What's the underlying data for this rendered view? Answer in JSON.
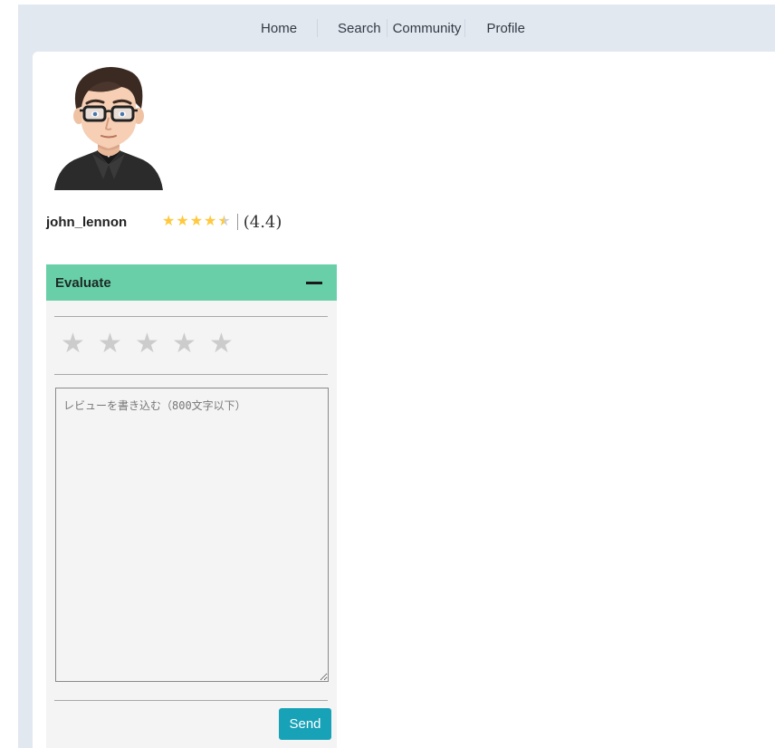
{
  "nav": {
    "items": [
      {
        "label": "Home"
      },
      {
        "label": "Search"
      },
      {
        "label": "Community"
      },
      {
        "label": "Profile"
      }
    ]
  },
  "profile": {
    "username": "john_lennon",
    "rating_value": 4.4,
    "rating_text": "(4.4)",
    "avatar_icon": "cartoon-man-avatar"
  },
  "evaluate": {
    "title": "Evaluate",
    "collapse_icon": "minus-icon",
    "star_count": 5,
    "selected_stars": 0,
    "review_placeholder": "レビューを書き込む（800文字以下）",
    "review_value": "",
    "send_label": "Send"
  },
  "colors": {
    "header_green": "#68cfa8",
    "send_button": "#17a2b8",
    "star_filled": "#ffc83d",
    "star_empty": "#cccccc",
    "page_bg": "#e2e8f0"
  }
}
